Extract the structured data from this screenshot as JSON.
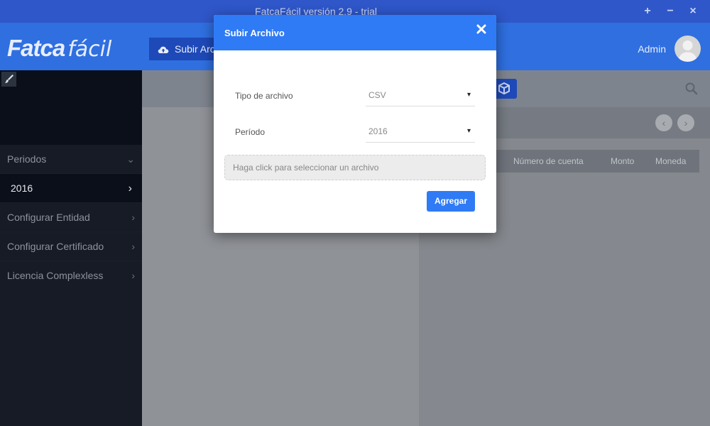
{
  "window": {
    "title": "FatcaFácil versión 2.9 - trial",
    "controls": [
      "+",
      "−",
      "×"
    ]
  },
  "header": {
    "logo_part1": "Fatca",
    "logo_part2": "fácil",
    "upload_label": "Subir Arc",
    "user_name": "Admin"
  },
  "sidebar": {
    "items": [
      {
        "label": "Periodos",
        "chevron": "⌄"
      },
      {
        "label": "2016",
        "chevron": "›"
      },
      {
        "label": "Configurar Entidad",
        "chevron": "›"
      },
      {
        "label": "Configurar Certificado",
        "chevron": "›"
      },
      {
        "label": "Licencia Complexless",
        "chevron": "›"
      }
    ]
  },
  "table": {
    "headers": [
      "Número de cuenta",
      "Monto",
      "Moneda"
    ]
  },
  "pager": {
    "prev": "‹",
    "next": "›"
  },
  "modal": {
    "title": "Subir Archivo",
    "file_type_label": "Tipo de archivo",
    "file_type_value": "CSV",
    "period_label": "Período",
    "period_value": "2016",
    "caret": "▾",
    "file_placeholder": "Haga click para seleccionar un archivo",
    "add_label": "Agregar"
  },
  "colors": {
    "titlebar": "#2f57c9",
    "header": "#2f6fe0",
    "modal_accent": "#2f7bf5",
    "sidebar": "#161b26"
  },
  "icons": [
    "cloud-upload-icon",
    "user-avatar-icon",
    "paintbrush-icon",
    "cube-icon",
    "search-icon",
    "close-icon",
    "chevron-down-icon",
    "chevron-right-icon",
    "chevron-left-icon"
  ]
}
